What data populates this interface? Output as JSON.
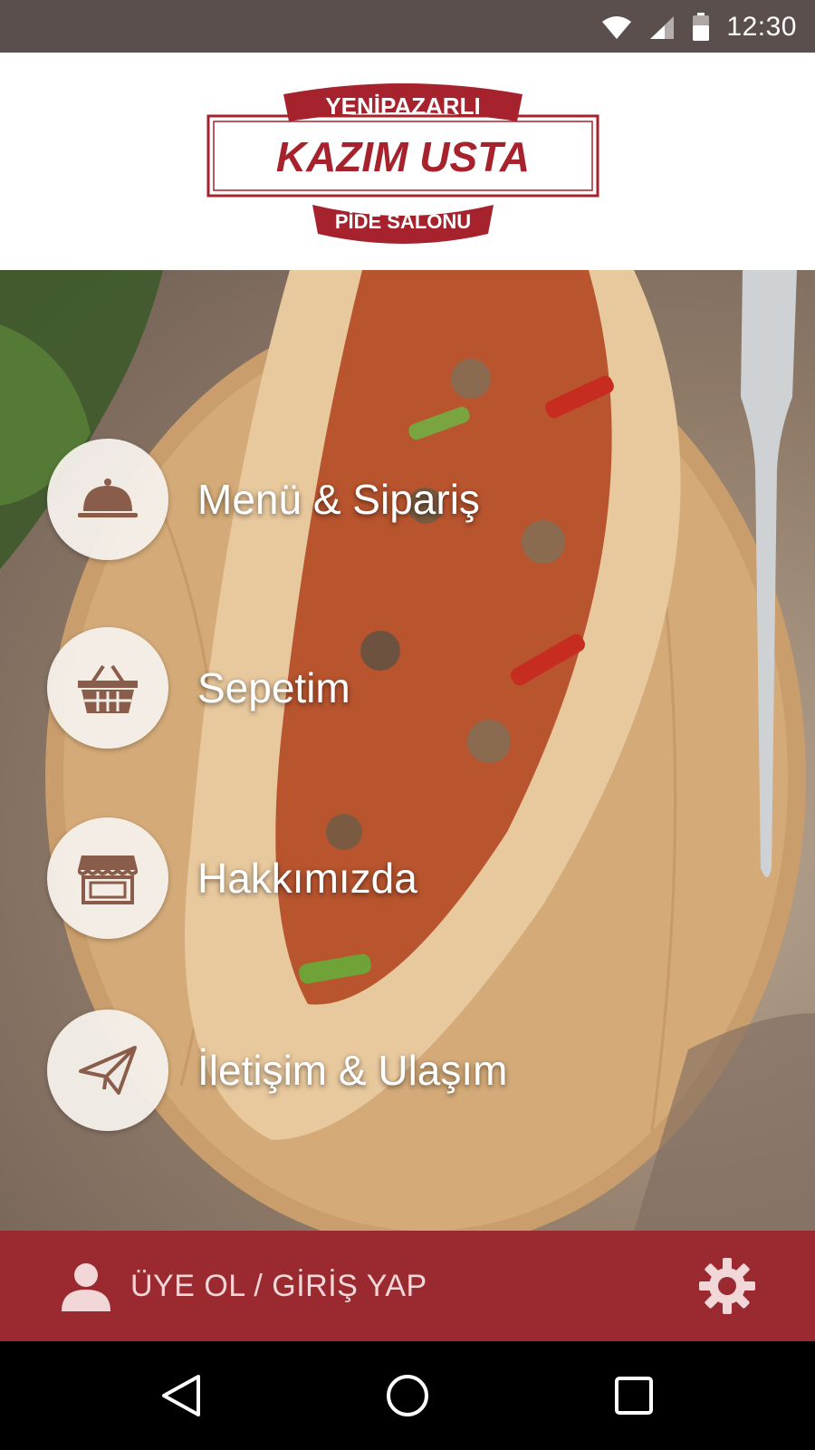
{
  "status_bar": {
    "time": "12:30",
    "icons": [
      "wifi-icon",
      "signal-icon",
      "battery-icon"
    ]
  },
  "logo": {
    "top_text": "YENİPAZARLI",
    "main_text": "KAZIM USTA",
    "bottom_text": "PİDE SALONU",
    "brand_color": "#a6232d"
  },
  "menu": {
    "items": [
      {
        "label": "Menü & Sipariş",
        "icon": "cloche-icon"
      },
      {
        "label": "Sepetim",
        "icon": "basket-icon"
      },
      {
        "label": "Hakkımızda",
        "icon": "store-icon"
      },
      {
        "label": "İletişim & Ulaşım",
        "icon": "paper-plane-icon"
      }
    ]
  },
  "bottom_bar": {
    "login_label": "ÜYE OL / GİRİŞ YAP",
    "login_icon": "user-icon",
    "settings_icon": "gear-icon",
    "bar_color": "#9b2a30"
  },
  "nav_bar": {
    "buttons": [
      "back-icon",
      "home-icon",
      "recents-icon"
    ]
  }
}
